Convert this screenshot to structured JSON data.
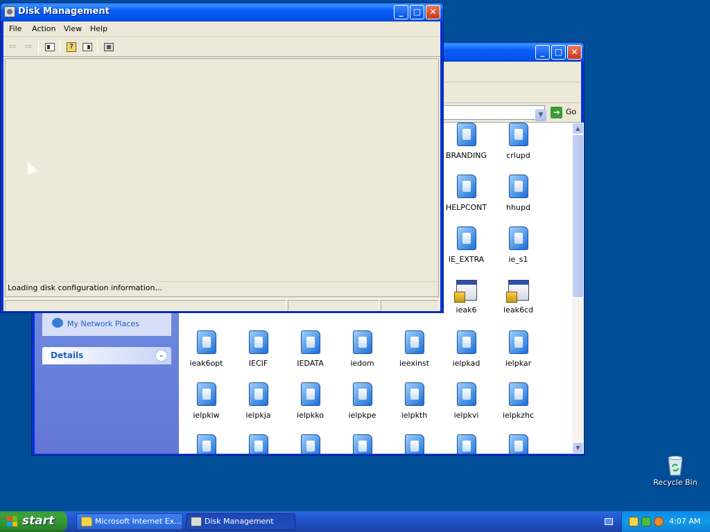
{
  "desktop": {
    "background_color": "#004e98",
    "icons": [
      {
        "label": "Recycle Bin",
        "icon": "recycle-bin-icon"
      }
    ]
  },
  "explorer_window": {
    "title": "",
    "go_label": "Go",
    "task_pane": {
      "other_places_link": "My Network Places",
      "details_header": "Details"
    },
    "files": [
      {
        "name": "BRANDING",
        "type": "folder"
      },
      {
        "name": "crlupd",
        "type": "folder"
      },
      {
        "name": "HELPCONT",
        "type": "folder"
      },
      {
        "name": "hhupd",
        "type": "folder"
      },
      {
        "name": "IE_EXTRA",
        "type": "folder"
      },
      {
        "name": "ie_s1",
        "type": "folder"
      },
      {
        "name": "ieak6",
        "type": "application"
      },
      {
        "name": "ieak6cd",
        "type": "application"
      },
      {
        "name": "ieak6opt",
        "type": "folder"
      },
      {
        "name": "IECIF",
        "type": "folder"
      },
      {
        "name": "IEDATA",
        "type": "folder"
      },
      {
        "name": "iedom",
        "type": "folder"
      },
      {
        "name": "ieexinst",
        "type": "folder"
      },
      {
        "name": "ielpkad",
        "type": "folder"
      },
      {
        "name": "ielpkar",
        "type": "folder"
      },
      {
        "name": "ielpkiw",
        "type": "folder"
      },
      {
        "name": "ielpkja",
        "type": "folder"
      },
      {
        "name": "ielpkko",
        "type": "folder"
      },
      {
        "name": "ielpkpe",
        "type": "folder"
      },
      {
        "name": "ielpkth",
        "type": "folder"
      },
      {
        "name": "ielpkvi",
        "type": "folder"
      },
      {
        "name": "ielpkzhc",
        "type": "folder"
      },
      {
        "name": "",
        "type": "folder"
      },
      {
        "name": "",
        "type": "folder"
      },
      {
        "name": "",
        "type": "folder"
      },
      {
        "name": "",
        "type": "folder"
      },
      {
        "name": "",
        "type": "folder"
      },
      {
        "name": "",
        "type": "folder"
      },
      {
        "name": "",
        "type": "folder"
      }
    ]
  },
  "disk_management": {
    "title": "Disk Management",
    "menu": [
      "File",
      "Action",
      "View",
      "Help"
    ],
    "toolbar": [
      "back-arrow-icon",
      "forward-arrow-icon",
      "show-hide-tree-icon",
      "help-topics-icon",
      "show-hide-action-pane-icon",
      "properties-icon"
    ],
    "status_message": "Loading disk configuration information..."
  },
  "taskbar": {
    "start_label": "start",
    "tasks": [
      {
        "label": "Microsoft Internet Ex...",
        "icon": "folder-icon",
        "active": false
      },
      {
        "label": "Disk Management",
        "icon": "disk-management-icon",
        "active": true
      }
    ],
    "clock": "4:07 AM"
  }
}
